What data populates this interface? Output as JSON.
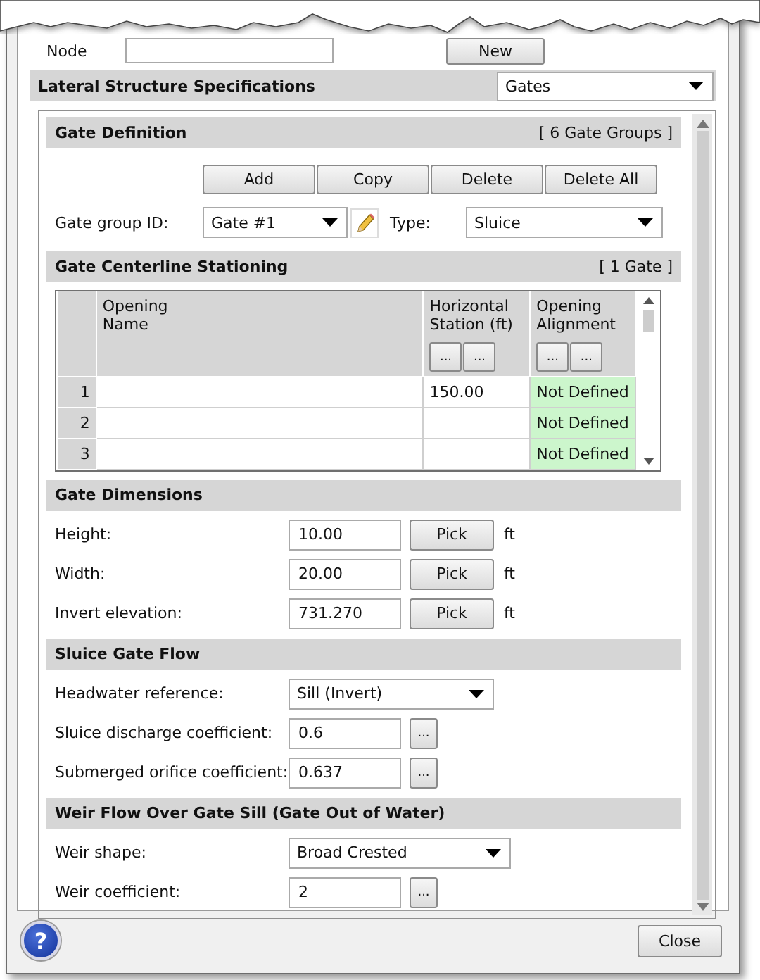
{
  "header": {
    "node_label": "Node",
    "new_button": "New"
  },
  "structure": {
    "label": "Lateral Structure Specifications",
    "type": "Gates"
  },
  "gate_definition": {
    "title": "Gate Definition",
    "count": "[ 6 Gate Groups ]",
    "buttons": [
      "Add",
      "Copy",
      "Delete",
      "Delete All"
    ],
    "group_label": "Gate group ID:",
    "group_value": "Gate #1",
    "type_label": "Type:",
    "type_value": "Sluice"
  },
  "stationing": {
    "title": "Gate Centerline Stationing",
    "count": "[ 1 Gate ]",
    "columns": [
      {
        "lines": [
          "Opening",
          "Name"
        ]
      },
      {
        "lines": [
          "Horizontal",
          "Station (ft)"
        ],
        "buttons": [
          "...",
          "..."
        ]
      },
      {
        "lines": [
          "Opening",
          "Alignment"
        ],
        "buttons": [
          "...",
          "..."
        ]
      }
    ],
    "rows": [
      {
        "index": "1",
        "station": "150.00",
        "alignment": "Not Defined"
      },
      {
        "index": "2",
        "alignment": "Not Defined"
      },
      {
        "index": "3",
        "alignment": "Not Defined"
      }
    ]
  },
  "sections": [
    {
      "title": "Gate Dimensions",
      "fields": [
        {
          "kind": "pick",
          "label": "Height:",
          "value": "10.00",
          "button": "Pick",
          "unit": "ft"
        },
        {
          "kind": "pick",
          "label": "Width:",
          "value": "20.00",
          "button": "Pick",
          "unit": "ft"
        },
        {
          "kind": "pick",
          "label": "Invert elevation:",
          "value": "731.270",
          "button": "Pick",
          "unit": "ft"
        }
      ]
    },
    {
      "title": "Sluice Gate Flow",
      "fields": [
        {
          "kind": "dropdown",
          "label": "Headwater reference:",
          "value": "Sill (Invert)"
        },
        {
          "kind": "coefficient",
          "label": "Sluice discharge coefficient:",
          "value": "0.6",
          "button": "..."
        },
        {
          "kind": "coefficient",
          "label": "Submerged orifice coefficient:",
          "value": "0.637",
          "button": "..."
        }
      ]
    },
    {
      "title": "Weir Flow Over Gate Sill (Gate Out of Water)",
      "fields": [
        {
          "kind": "dropdown",
          "label": "Weir shape:",
          "value": "Broad Crested",
          "wide": true
        },
        {
          "kind": "coefficient",
          "label": "Weir coefficient:",
          "value": "2",
          "button": "..."
        }
      ]
    }
  ],
  "footer": {
    "help": "?",
    "close": "Close"
  }
}
